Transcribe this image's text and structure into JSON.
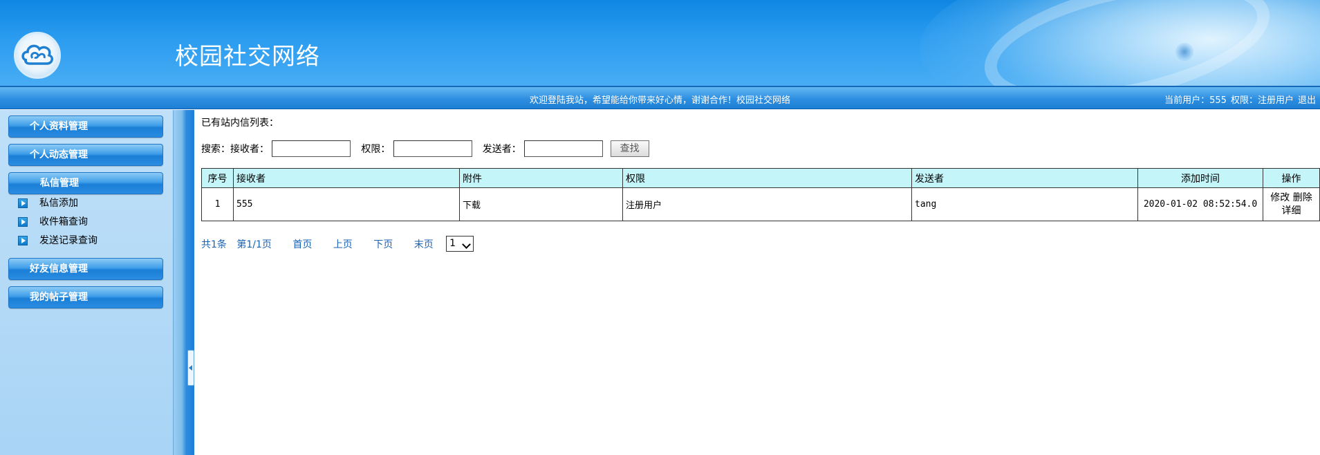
{
  "header": {
    "site_title": "校园社交网络"
  },
  "welcome_bar": {
    "message": "欢迎登陆我站，希望能给你带来好心情，谢谢合作！校园社交网络",
    "current_user": "当前用户：555",
    "permission": "权限：注册用户",
    "logout": "退出"
  },
  "sidebar": {
    "menus": [
      {
        "label": "个人资料管理"
      },
      {
        "label": "个人动态管理"
      },
      {
        "label": "私信管理"
      },
      {
        "label": "好友信息管理"
      },
      {
        "label": "我的帖子管理"
      }
    ],
    "sub_items": [
      {
        "label": "私信添加"
      },
      {
        "label": "收件箱查询"
      },
      {
        "label": "发送记录查询"
      }
    ]
  },
  "main": {
    "list_title": "已有站内信列表：",
    "search": {
      "prefix": "搜索：",
      "receiver_label": "接收者：",
      "receiver_value": "",
      "permission_label": "权限：",
      "permission_value": "",
      "sender_label": "发送者：",
      "sender_value": "",
      "button": "查找"
    },
    "table": {
      "headers": [
        "序号",
        "接收者",
        "附件",
        "权限",
        "发送者",
        "添加时间",
        "操作"
      ],
      "rows": [
        {
          "index": "1",
          "receiver": "555",
          "attachment": "下载",
          "permission": "注册用户",
          "sender": "tang",
          "time": "2020-01-02 08:52:54.0",
          "op_edit": "修改",
          "op_delete": "删除",
          "op_detail": "详细"
        }
      ]
    },
    "pager": {
      "total": "共1条",
      "page_info": "第1/1页",
      "first": "首页",
      "prev": "上页",
      "next": "下页",
      "last": "末页",
      "selected_page": "1"
    }
  }
}
